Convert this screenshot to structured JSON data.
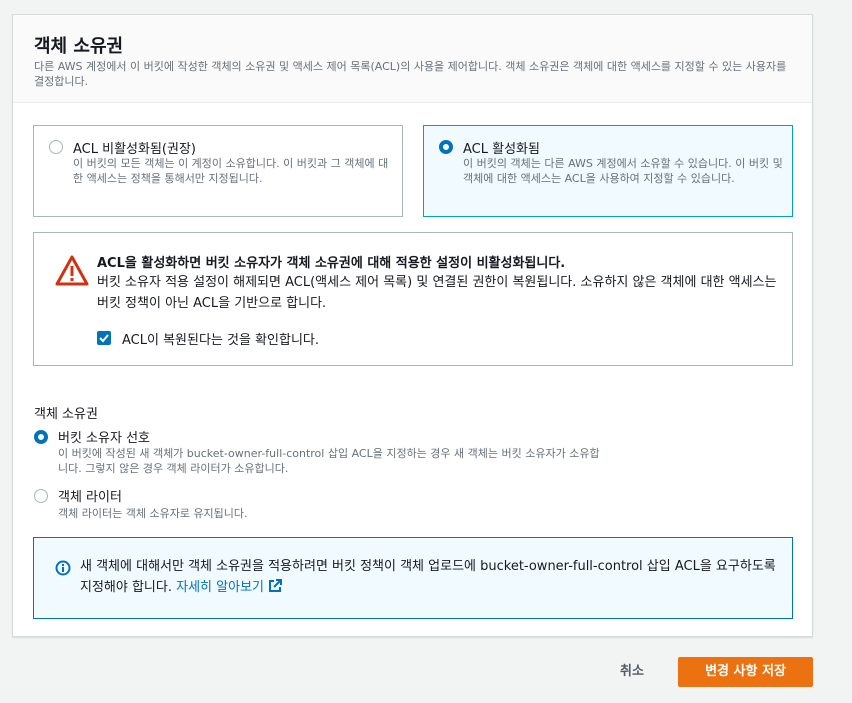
{
  "panel": {
    "title": "객체 소유권",
    "description": "다른 AWS 계정에서 이 버킷에 작성한 객체의 소유권 및 액세스 제어 목록(ACL)의 사용을 제어합니다. 객체 소유권은 객체에 대한 액세스를 지정할 수 있는 사용자를 결정합니다."
  },
  "acl_options": [
    {
      "label": "ACL 비활성화됨(권장)",
      "description": "이 버킷의 모든 객체는 이 계정이 소유합니다. 이 버킷과 그 객체에 대한 액세스는 정책을 통해서만 지정됩니다.",
      "selected": false
    },
    {
      "label": "ACL 활성화됨",
      "description": "이 버킷의 객체는 다른 AWS 계정에서 소유할 수 있습니다. 이 버킷 및 객체에 대한 액세스는 ACL을 사용하여 지정할 수 있습니다.",
      "selected": true
    }
  ],
  "warning": {
    "title": "ACL을 활성화하면 버킷 소유자가 객체 소유권에 대해 적용한 설정이 비활성화됩니다.",
    "body": "버킷 소유자 적용 설정이 해제되면 ACL(액세스 제어 목록) 및 연결된 권한이 복원됩니다. 소유하지 않은 객체에 대한 액세스는 버킷 정책이 아닌 ACL을 기반으로 합니다.",
    "checkbox_label": "ACL이 복원된다는 것을 확인합니다.",
    "checkbox_checked": true
  },
  "ownership": {
    "label": "객체 소유권",
    "options": [
      {
        "label": "버킷 소유자 선호",
        "description": "이 버킷에 작성된 새 객체가 bucket-owner-full-control 삽입 ACL을 지정하는 경우 새 객체는 버킷 소유자가 소유합니다. 그렇지 않은 경우 객체 라이터가 소유합니다.",
        "selected": true
      },
      {
        "label": "객체 라이터",
        "description": "객체 라이터는 객체 소유자로 유지됩니다.",
        "selected": false
      }
    ]
  },
  "info": {
    "text": "새 객체에 대해서만 객체 소유권을 적용하려면 버킷 정책이 객체 업로드에 bucket-owner-full-control 삽입 ACL을 요구하도록 지정해야 합니다.",
    "link": "자세히 알아보기"
  },
  "actions": {
    "cancel": "취소",
    "save": "변경 사항 저장"
  },
  "colors": {
    "accent": "#0073bb",
    "primary_button": "#ec7211",
    "warning": "#d13212"
  }
}
